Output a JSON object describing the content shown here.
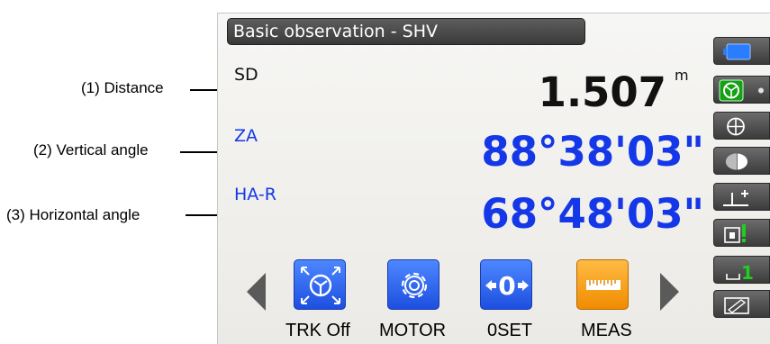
{
  "annotations": {
    "distance": "(1) Distance",
    "vertical_angle": "(2) Vertical angle",
    "horizontal_angle": "(3) Horizontal angle"
  },
  "screen": {
    "title": "Basic observation - SHV",
    "rows": [
      {
        "label": "SD",
        "value": "1.507",
        "unit": "m",
        "color": "#111111"
      },
      {
        "label": "ZA",
        "value": "88°38'03\"",
        "color": "#1437e8"
      },
      {
        "label": "HA-R",
        "value": "68°48'03\"",
        "color": "#1437e8"
      }
    ]
  },
  "softkeys": [
    {
      "label": "TRK Off",
      "icon": "tracking-icon"
    },
    {
      "label": "MOTOR",
      "icon": "gear-icon"
    },
    {
      "label": "0SET",
      "icon": "zero-set-icon"
    },
    {
      "label": "MEAS",
      "icon": "ruler-icon"
    }
  ],
  "status_icons": [
    "battery-icon",
    "target-type-icon",
    "laser-icon",
    "prism-constant-icon",
    "tilt-correction-icon",
    "memory-icon",
    "page-icon",
    "input-mode-icon"
  ],
  "colors": {
    "accent_blue": "#1d4fe0",
    "meas_orange": "#f08c00",
    "status_green": "#22cc22",
    "battery_blue": "#2a7dff"
  }
}
